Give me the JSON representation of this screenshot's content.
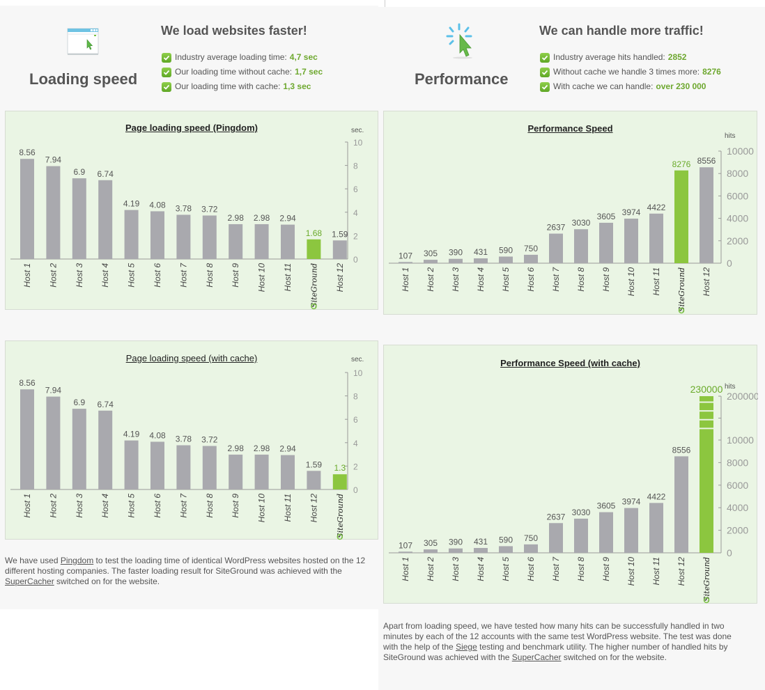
{
  "colors": {
    "bar": "#a9a9ae",
    "highlight": "#8cc63f",
    "highlight_text": "#6aaa2a",
    "axis": "#999999",
    "panel_bg": "#eaf5e4"
  },
  "loading": {
    "icon": "browser-window-cursor-icon",
    "label": "Loading speed",
    "heading": "We load websites faster!",
    "points": [
      {
        "text": "Industry average loading time:",
        "value": "4,7 sec"
      },
      {
        "text": "Our loading time without cache:",
        "value": "1,7 sec"
      },
      {
        "text": "Our loading time with cache:",
        "value": "1,3 sec"
      }
    ],
    "description": {
      "p1": "We have used ",
      "link1": "Pingdom",
      "p2": " to test the loading time of identical WordPress websites hosted on the 12 different hosting companies. The faster loading result for SiteGround was achieved with the ",
      "link2": "SuperCacher",
      "p3": " switched on for the website."
    }
  },
  "performance": {
    "icon": "cursor-click-burst-icon",
    "label": "Performance",
    "heading": "We can handle more traffic!",
    "points": [
      {
        "text": "Industry average hits handled:",
        "value": "2852"
      },
      {
        "text": "Without cache we handle 3 times more:",
        "value": "8276"
      },
      {
        "text": "With cache we can handle:",
        "value": "over 230 000"
      }
    ],
    "description": {
      "p1": "Apart from loading speed, we have tested how many hits can be successfully handled in two minutes by each of the 12 accounts with the same test WordPress website. The test was done with the help of the ",
      "link1": "Siege",
      "p2": " testing and benchmark utility. The higher number of handled hits by SiteGround was achieved with the ",
      "link2": "SuperCacher",
      "p3": " switched on for the website."
    }
  },
  "chart_data": [
    {
      "id": "pingdom",
      "type": "bar",
      "title": "Page loading speed (Pingdom)",
      "ylabel": "sec.",
      "ylim": [
        0,
        10
      ],
      "yticks": [
        0,
        2,
        4,
        6,
        8,
        10
      ],
      "axis_side": "right",
      "grid": false,
      "categories": [
        "Host 1",
        "Host 2",
        "Host 3",
        "Host 4",
        "Host 5",
        "Host 6",
        "Host 7",
        "Host 8",
        "Host 9",
        "Host 10",
        "Host 11",
        "SiteGround",
        "Host 12"
      ],
      "values": [
        8.56,
        7.94,
        6.9,
        6.74,
        4.19,
        4.08,
        3.78,
        3.72,
        2.98,
        2.98,
        2.94,
        1.68,
        1.59
      ],
      "labels": [
        "8.56",
        "7.94",
        "6.9",
        "6.74",
        "4.19",
        "4.08",
        "3.78",
        "3.72",
        "2.98",
        "2.98",
        "2.94",
        "1.68",
        "1.59"
      ],
      "highlight": "SiteGround"
    },
    {
      "id": "perf",
      "type": "bar",
      "title": "Performance Speed",
      "ylabel": "hits",
      "ylim": [
        0,
        10000
      ],
      "yticks": [
        0,
        2000,
        4000,
        6000,
        8000,
        10000
      ],
      "axis_side": "right",
      "grid": false,
      "categories": [
        "Host 1",
        "Host 2",
        "Host 3",
        "Host 4",
        "Host 5",
        "Host 6",
        "Host 7",
        "Host 8",
        "Host 9",
        "Host 10",
        "Host 11",
        "SiteGround",
        "Host 12"
      ],
      "values": [
        107,
        305,
        390,
        431,
        590,
        750,
        2637,
        3030,
        3605,
        3974,
        4422,
        8276,
        8556
      ],
      "labels": [
        "107",
        "305",
        "390",
        "431",
        "590",
        "750",
        "2637",
        "3030",
        "3605",
        "3974",
        "4422",
        "8276",
        "8556"
      ],
      "highlight": "SiteGround"
    },
    {
      "id": "cache",
      "type": "bar",
      "title": "Page loading speed (with cache)",
      "ylabel": "sec.",
      "ylim": [
        0,
        10
      ],
      "yticks": [
        0,
        2,
        4,
        6,
        8,
        10
      ],
      "axis_side": "right",
      "grid": false,
      "categories": [
        "Host 1",
        "Host 2",
        "Host 3",
        "Host 4",
        "Host 5",
        "Host 6",
        "Host 7",
        "Host 8",
        "Host 9",
        "Host 10",
        "Host 11",
        "Host 12",
        "SiteGround"
      ],
      "values": [
        8.56,
        7.94,
        6.9,
        6.74,
        4.19,
        4.08,
        3.78,
        3.72,
        2.98,
        2.98,
        2.94,
        1.59,
        1.3
      ],
      "labels": [
        "8.56",
        "7.94",
        "6.9",
        "6.74",
        "4.19",
        "4.08",
        "3.78",
        "3.72",
        "2.98",
        "2.98",
        "2.94",
        "1.59",
        "1.3"
      ],
      "highlight": "SiteGround"
    },
    {
      "id": "perfcache",
      "type": "bar",
      "title": "Performance Speed (with cache)",
      "ylabel": "hits",
      "ylim": [
        0,
        200000
      ],
      "axis_break": [
        10000,
        200000
      ],
      "yticks": [
        0,
        2000,
        4000,
        6000,
        8000,
        10000,
        200000
      ],
      "axis_side": "right",
      "grid": false,
      "categories": [
        "Host 1",
        "Host 2",
        "Host 3",
        "Host 4",
        "Host 5",
        "Host 6",
        "Host 7",
        "Host 8",
        "Host 9",
        "Host 10",
        "Host 11",
        "Host 12",
        "SiteGround"
      ],
      "values": [
        107,
        305,
        390,
        431,
        590,
        750,
        2637,
        3030,
        3605,
        3974,
        4422,
        8556,
        230000
      ],
      "labels": [
        "107",
        "305",
        "390",
        "431",
        "590",
        "750",
        "2637",
        "3030",
        "3605",
        "3974",
        "4422",
        "8556",
        "230000"
      ],
      "highlight": "SiteGround"
    }
  ]
}
